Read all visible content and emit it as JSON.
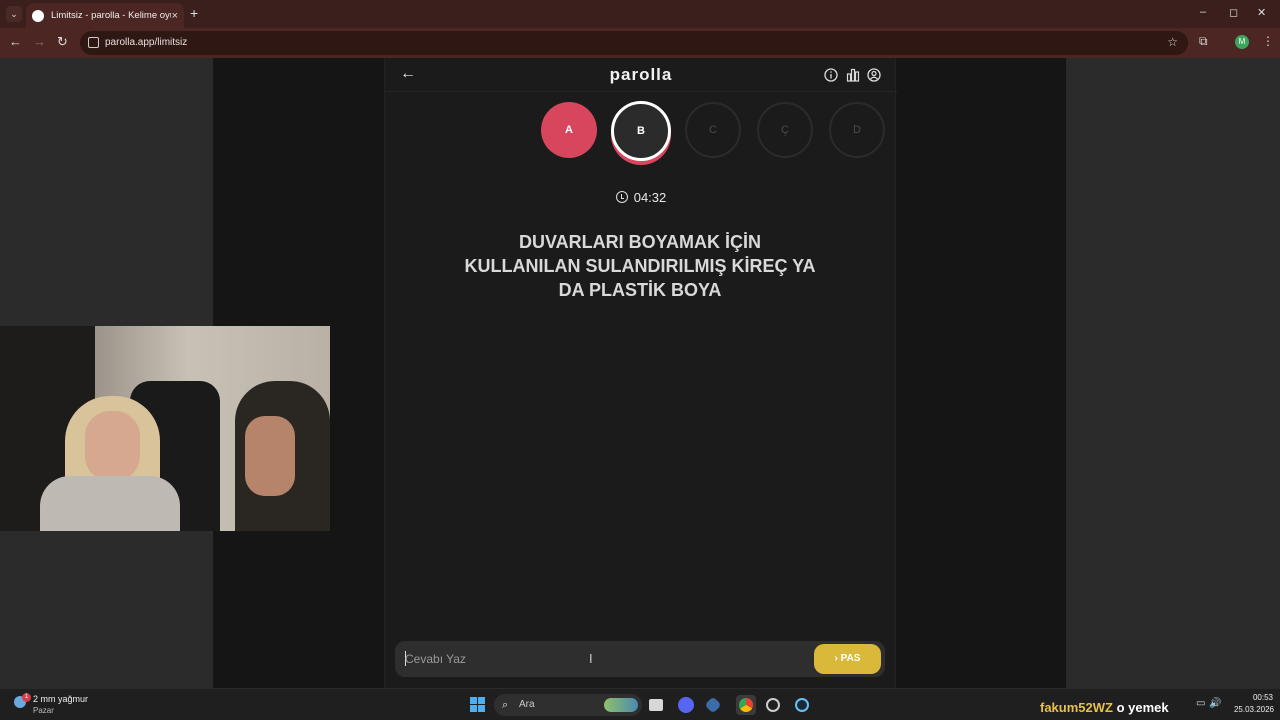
{
  "browser": {
    "tab_title": "Limitsiz - parolla - Kelime oyunu",
    "tab_close": "×",
    "new_tab": "+",
    "url": "parolla.app/limitsiz",
    "win_min": "–",
    "win_max": "◻",
    "win_close": "✕"
  },
  "app": {
    "logo": "parolla",
    "letters": [
      {
        "label": "A",
        "state": "done"
      },
      {
        "label": "B",
        "state": "current"
      },
      {
        "label": "C",
        "state": "pending"
      },
      {
        "label": "Ç",
        "state": "pending"
      },
      {
        "label": "D",
        "state": "pending"
      }
    ],
    "timer": "04:32",
    "question_lines": [
      "DUVARLARI BOYAMAK İÇİN",
      "KULLANILAN SULANDIRILMIŞ KİREÇ YA",
      "DA PLASTİK BOYA"
    ],
    "answer_placeholder": "Cevabı Yaz",
    "pass_label": "PAS",
    "pass_icon": "›"
  },
  "taskbar": {
    "weather_main": "2 mm yağmur",
    "weather_sub": "Pazar",
    "weather_badge": "1",
    "search_label": "Ara",
    "stream_name": "fakum52WZ",
    "stream_word": "o yemek",
    "time": "00:53",
    "date": "25.03.2026"
  },
  "colors": {
    "accent_red": "#d8465e",
    "accent_yellow": "#d9b83a",
    "background": "#1b1b1b"
  }
}
